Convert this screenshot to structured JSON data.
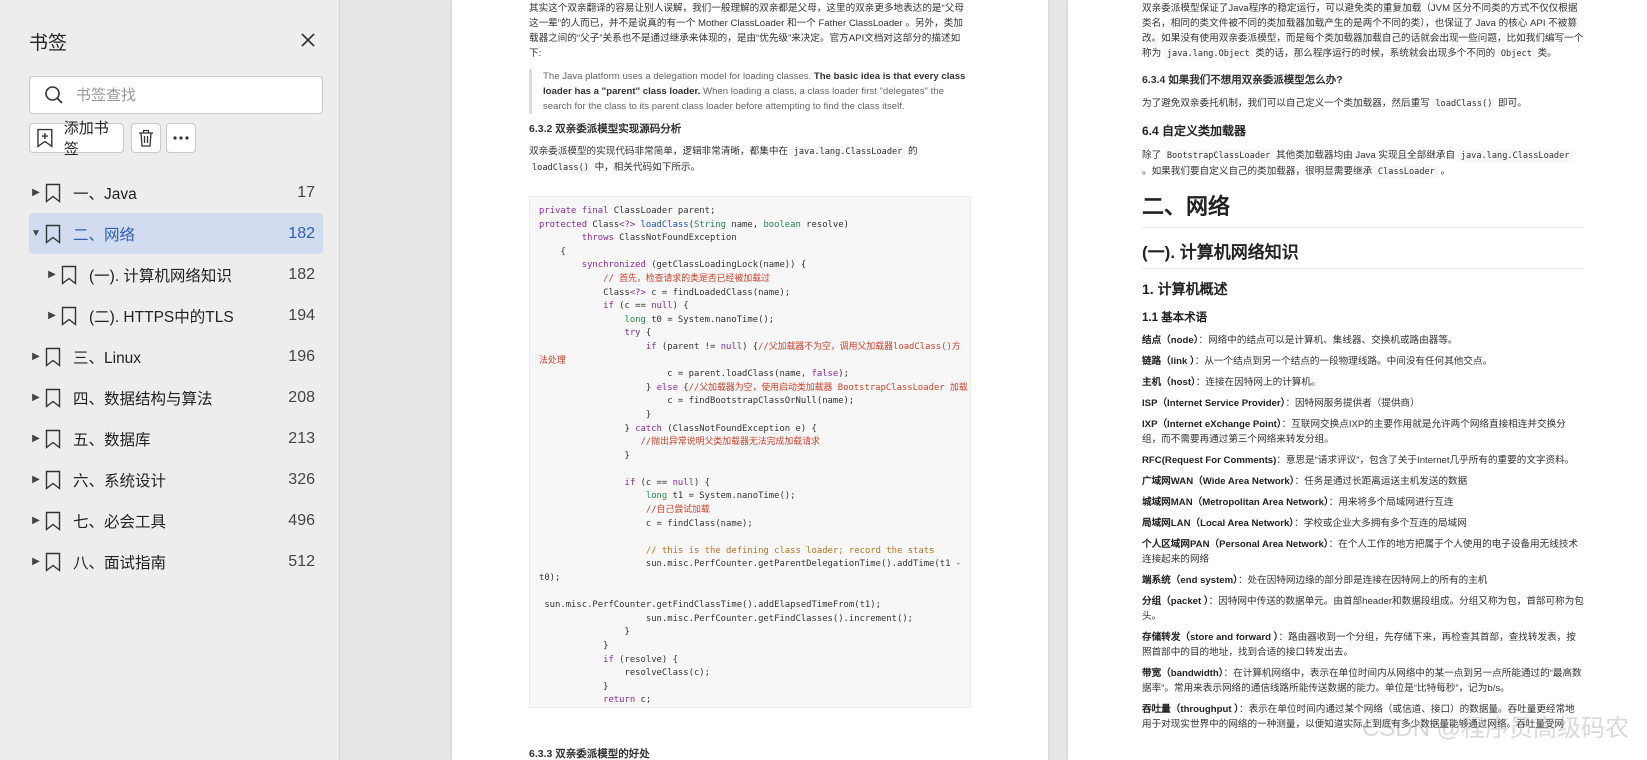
{
  "sidebar": {
    "title": "书签",
    "search_placeholder": "书签查找",
    "add_label": "添加书签",
    "items": [
      {
        "label": "一、Java",
        "page": "17",
        "expanded": false,
        "level": 0
      },
      {
        "label": "二、网络",
        "page": "182",
        "expanded": true,
        "level": 0,
        "selected": true
      },
      {
        "label": "(一). 计算机网络知识",
        "page": "182",
        "expanded": false,
        "level": 1
      },
      {
        "label": "(二). HTTPS中的TLS",
        "page": "194",
        "expanded": false,
        "level": 1
      },
      {
        "label": "三、Linux",
        "page": "196",
        "expanded": false,
        "level": 0
      },
      {
        "label": "四、数据结构与算法",
        "page": "208",
        "expanded": false,
        "level": 0
      },
      {
        "label": "五、数据库",
        "page": "213",
        "expanded": false,
        "level": 0
      },
      {
        "label": "六、系统设计",
        "page": "326",
        "expanded": false,
        "level": 0
      },
      {
        "label": "七、必会工具",
        "page": "496",
        "expanded": false,
        "level": 0
      },
      {
        "label": "八、面试指南",
        "page": "512",
        "expanded": false,
        "level": 0
      }
    ]
  },
  "page1": {
    "intro1": "其实这个双亲翻译的容易让别人误解，我们一般理解的双亲都是父母，这里的双亲更多地表达的是“父母这一辈”的人而已，并不是说真的有一个 Mother ClassLoader 和一个 Father ClassLoader 。另外，类加载器之间的“父子”关系也不是通过继承来体现的，是由“优先级”来决定。官方API文档对这部分的描述如下:",
    "quote_a": "The Java platform uses a delegation model for loading classes.",
    "quote_b": "The basic idea is that every class loader has a \"parent\" class loader.",
    "quote_c": "When loading a class, a class loader first \"delegates\" the search for the class to its parent class loader before attempting to find the class itself.",
    "heading": "6.3.2 双亲委派模型实现源码分析",
    "intro2a": "双亲委派模型的实现代码非常简单，逻辑非常清晰，都集中在",
    "intro2_code1": "java.lang.ClassLoader",
    "intro2b": "的",
    "intro2_code2": "loadClass()",
    "intro2c": "中，相关代码如下所示。",
    "bottom_heading": "6.3.3 双亲委派模型的好处"
  },
  "page2": {
    "top_text_a": "双亲委派模型保证了Java程序的稳定运行，可以避免类的重复加载（JVM 区分不同类的方式不仅仅根据类名，相同的类文件被不同的类加载器加载产生的是两个不同的类），也保证了 Java 的核心 API 不被篡改。如果没有使用双亲委派模型，而是每个类加载器加载自己的话就会出现一些问题，比如我们编写一个称为",
    "top_code1": "java.lang.Object",
    "top_text_b": "类的话，那么程序运行的时候，系统就会出现多个不同的",
    "top_code2": "Object",
    "top_text_c": "类。",
    "h_634": "6.3.4 如果我们不想用双亲委派模型怎么办?",
    "p_634a": "为了避免双亲委托机制，我们可以自己定义一个类加载器，然后重写",
    "p_634_code": "loadClass()",
    "p_634b": "即可。",
    "h_64": "6.4 自定义类加载器",
    "p_64a": "除了",
    "p_64_code1": "BootstrapClassLoader",
    "p_64b": "其他类加载器均由 Java 实现且全部继承自",
    "p_64_code2": "java.lang.ClassLoader",
    "p_64c": "。如果我们要自定义自己的类加载器，很明显需要继承",
    "p_64_code3": "ClassLoader",
    "p_64d": "。",
    "h1": "二、网络",
    "h2": "(一). 计算机网络知识",
    "h3": "1. 计算机概述",
    "h35": "1.1 基本术语",
    "terms": [
      {
        "t": "结点（node）",
        "d": "：网络中的结点可以是计算机、集线器、交换机或路由器等。"
      },
      {
        "t": "链路（link ）",
        "d": "：从一个结点到另一个结点的一段物理线路。中间没有任何其他交点。"
      },
      {
        "t": "主机（host）",
        "d": "：连接在因特网上的计算机。"
      },
      {
        "t": "ISP（Internet Service Provider）",
        "d": "：因特网服务提供者（提供商）"
      },
      {
        "t": "IXP（Internet eXchange Point）",
        "d": "：互联网交换点IXP的主要作用就是允许两个网络直接相连并交换分组，而不需要再通过第三个网络来转发分组。"
      },
      {
        "t": "RFC(Request For Comments)",
        "d": "：意思是“请求评议”，包含了关于Internet几乎所有的重要的文字资料。"
      },
      {
        "t": "广域网WAN（Wide Area Network）",
        "d": "：任务是通过长距离运送主机发送的数据"
      },
      {
        "t": "城域网MAN（Metropolitan Area Network）",
        "d": "：用来将多个局域网进行互连"
      },
      {
        "t": "局域网LAN（Local Area Network）",
        "d": "：学校或企业大多拥有多个互连的局域网"
      },
      {
        "t": "个人区域网PAN（Personal Area Network）",
        "d": "：在个人工作的地方把属于个人使用的电子设备用无线技术连接起来的网络"
      },
      {
        "t": "端系统（end system）",
        "d": "：处在因特网边缘的部分即是连接在因特网上的所有的主机"
      },
      {
        "t": "分组（packet ）",
        "d": "：因特网中传送的数据单元。由首部header和数据段组成。分组又称为包，首部可称为包头。"
      },
      {
        "t": "存储转发（store and forward ）",
        "d": "：路由器收到一个分组，先存储下来，再检查其首部，查找转发表，按照首部中的目的地址，找到合适的接口转发出去。"
      },
      {
        "t": "带宽（bandwidth）",
        "d": "：在计算机网络中，表示在单位时间内从网络中的某一点到另一点所能通过的“最高数据率”。常用来表示网络的通信线路所能传送数据的能力。单位是“比特每秒”，记为b/s。"
      },
      {
        "t": "吞吐量（throughput ）",
        "d": "：表示在单位时间内通过某个网络（或信道、接口）的数据量。吞吐量更经常地用于对现实世界中的网络的一种测量，以便知道实际上到底有多少数据量能够通过网络。吞吐量受网"
      }
    ],
    "watermark": "CSDN @程序员高级码农"
  }
}
